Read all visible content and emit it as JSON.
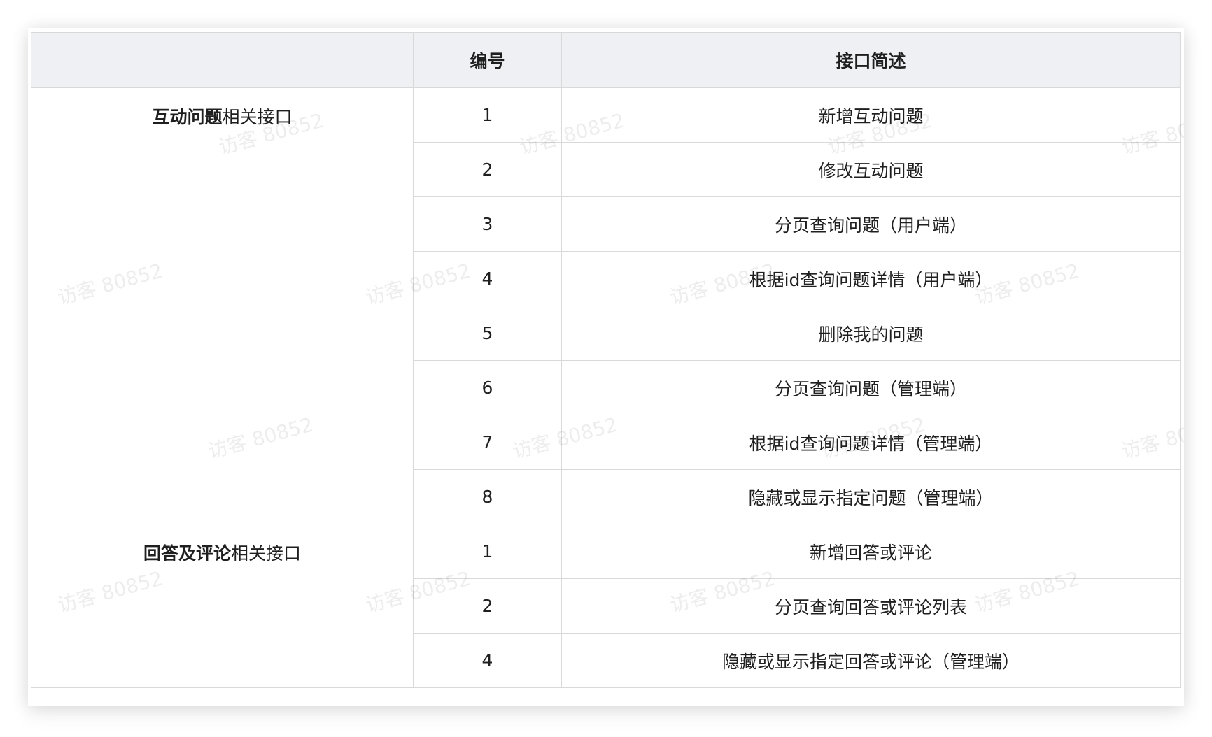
{
  "table": {
    "headers": [
      "",
      "编号",
      "接口简述"
    ],
    "groups": [
      {
        "title_bold": "互动问题",
        "title_rest": "相关接口",
        "rows": [
          {
            "num": "1",
            "desc": "新增互动问题"
          },
          {
            "num": "2",
            "desc": "修改互动问题"
          },
          {
            "num": "3",
            "desc": "分页查询问题（用户端）"
          },
          {
            "num": "4",
            "desc": "根据id查询问题详情（用户端）"
          },
          {
            "num": "5",
            "desc": "删除我的问题"
          },
          {
            "num": "6",
            "desc": "分页查询问题（管理端）"
          },
          {
            "num": "7",
            "desc": "根据id查询问题详情（管理端）"
          },
          {
            "num": "8",
            "desc": "隐藏或显示指定问题（管理端）"
          }
        ]
      },
      {
        "title_bold": "回答及评论",
        "title_rest": "相关接口",
        "rows": [
          {
            "num": "1",
            "desc": "新增回答或评论"
          },
          {
            "num": "2",
            "desc": "分页查询回答或评论列表"
          },
          {
            "num": "4",
            "desc": "隐藏或显示指定回答或评论（管理端）"
          }
        ]
      }
    ]
  },
  "watermark": "访客 80852"
}
